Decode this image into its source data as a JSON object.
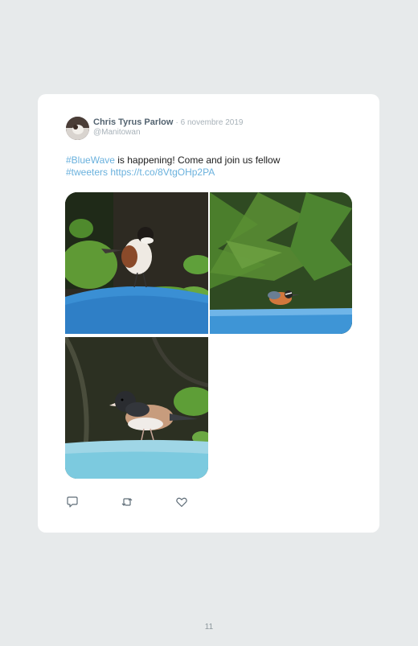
{
  "tweet": {
    "author_name": "Chris Tyrus Parlow",
    "date": "· 6 novembre 2019",
    "handle": "@Manitowan",
    "hashtag1": "#BlueWave",
    "text_middle": " is happening! Come and join us fellow ",
    "hashtag2": "#tweeters",
    "link": "https://t.co/8VtgOHp2PA"
  },
  "photos": [
    {
      "subject": "chickadee on blue feeder"
    },
    {
      "subject": "nuthatch on blue feeder"
    },
    {
      "subject": "junco on blue feeder"
    }
  ],
  "actions": {
    "reply_icon": "comment-icon",
    "retweet_icon": "retweet-icon",
    "like_icon": "heart-icon"
  },
  "page": {
    "number": "11"
  },
  "colors": {
    "background": "#e7eaeb",
    "card": "#ffffff",
    "link": "#6ab1dd",
    "name": "#536370",
    "muted": "#a8b2b9"
  }
}
